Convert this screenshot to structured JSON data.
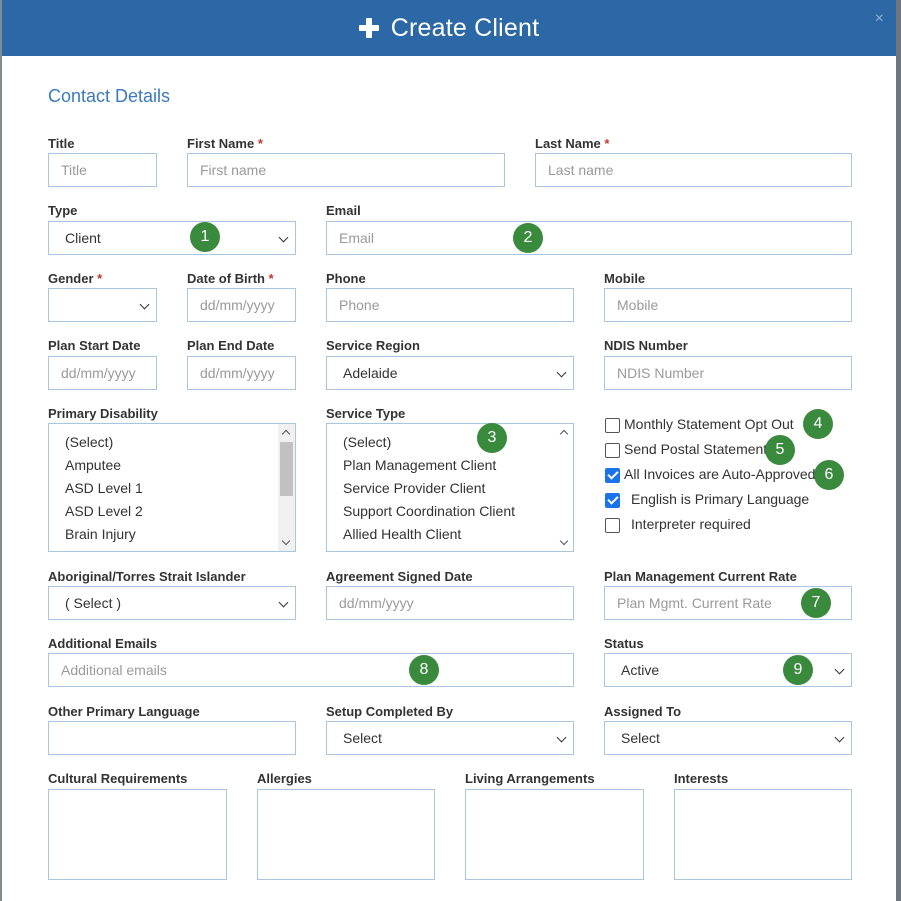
{
  "header": {
    "title": "Create Client",
    "close_glyph": "×"
  },
  "section": {
    "title": "Contact Details"
  },
  "required_marker": "*",
  "fields": {
    "title": {
      "label": "Title",
      "placeholder": "Title"
    },
    "first_name": {
      "label": "First Name",
      "placeholder": "First name",
      "required": true
    },
    "last_name": {
      "label": "Last Name",
      "placeholder": "Last name",
      "required": true
    },
    "type": {
      "label": "Type",
      "value": "Client"
    },
    "email": {
      "label": "Email",
      "placeholder": "Email"
    },
    "gender": {
      "label": "Gender",
      "value": "",
      "required": true
    },
    "dob": {
      "label": "Date of Birth",
      "placeholder": "dd/mm/yyyy",
      "required": true
    },
    "phone": {
      "label": "Phone",
      "placeholder": "Phone"
    },
    "mobile": {
      "label": "Mobile",
      "placeholder": "Mobile"
    },
    "plan_start": {
      "label": "Plan Start Date",
      "placeholder": "dd/mm/yyyy"
    },
    "plan_end": {
      "label": "Plan End Date",
      "placeholder": "dd/mm/yyyy"
    },
    "service_region": {
      "label": "Service Region",
      "value": "Adelaide"
    },
    "ndis_number": {
      "label": "NDIS Number",
      "placeholder": "NDIS Number"
    },
    "primary_disability": {
      "label": "Primary Disability",
      "options": [
        "(Select)",
        "Amputee",
        "ASD Level 1",
        "ASD Level 2",
        "Brain Injury"
      ]
    },
    "service_type": {
      "label": "Service Type",
      "options": [
        "(Select)",
        "Plan Management Client",
        "Service Provider Client",
        "Support Coordination Client",
        "Allied Health Client"
      ]
    },
    "aboriginal": {
      "label": "Aboriginal/Torres Strait Islander",
      "value": "( Select )"
    },
    "agreement_signed": {
      "label": "Agreement Signed Date",
      "placeholder": "dd/mm/yyyy"
    },
    "plan_mgmt_rate": {
      "label": "Plan Management Current Rate",
      "placeholder": "Plan Mgmt. Current Rate"
    },
    "additional_emails": {
      "label": "Additional Emails",
      "placeholder": "Additional emails"
    },
    "status": {
      "label": "Status",
      "value": "Active"
    },
    "other_language": {
      "label": "Other Primary Language",
      "value": ""
    },
    "setup_completed_by": {
      "label": "Setup Completed By",
      "value": "Select"
    },
    "assigned_to": {
      "label": "Assigned To",
      "value": "Select"
    },
    "cultural": {
      "label": "Cultural Requirements"
    },
    "allergies": {
      "label": "Allergies"
    },
    "living": {
      "label": "Living Arrangements"
    },
    "interests": {
      "label": "Interests"
    }
  },
  "checkboxes": [
    {
      "label": "Monthly Statement Opt Out",
      "checked": false
    },
    {
      "label": "Send Postal Statement",
      "checked": false
    },
    {
      "label": "All Invoices are Auto-Approved",
      "checked": true
    },
    {
      "label": "English is Primary Language",
      "checked": true
    },
    {
      "label": "Interpreter required",
      "checked": false
    }
  ],
  "badges": [
    "1",
    "2",
    "3",
    "4",
    "5",
    "6",
    "7",
    "8",
    "9"
  ],
  "colors": {
    "header": "#2b68a5",
    "accent": "#3a7abd",
    "badge": "#3a8a3e",
    "required": "#c0392b",
    "checkbox": "#1a73e8"
  }
}
